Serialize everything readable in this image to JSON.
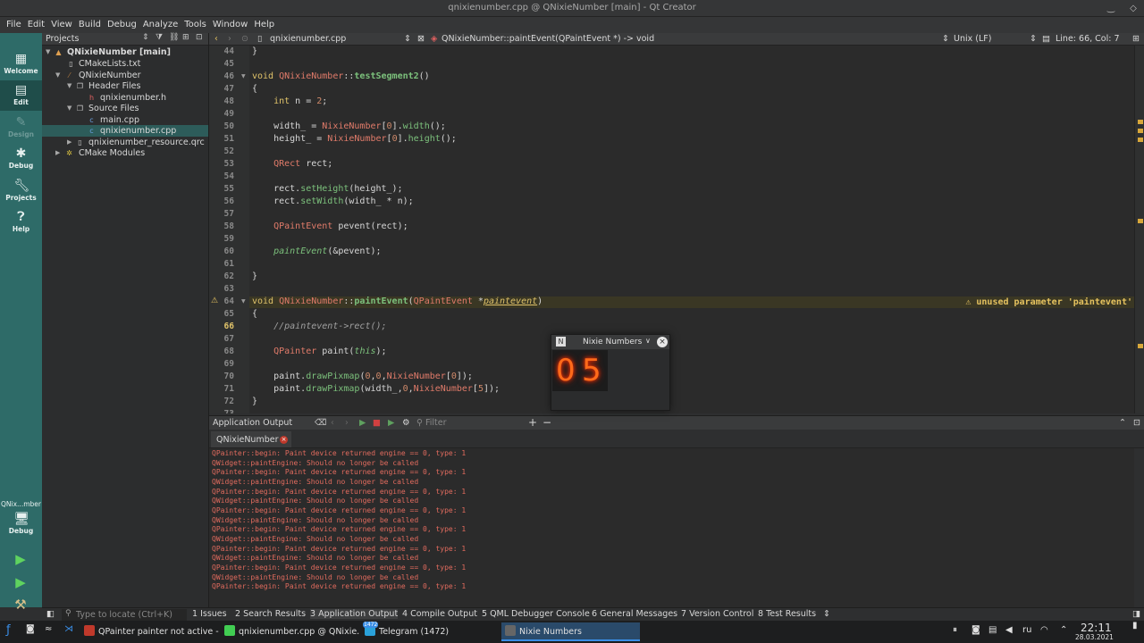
{
  "window": {
    "title": "qnixienumber.cpp @ QNixieNumber [main] - Qt Creator"
  },
  "menu": [
    "File",
    "Edit",
    "View",
    "Build",
    "Debug",
    "Analyze",
    "Tools",
    "Window",
    "Help"
  ],
  "modes": [
    {
      "label": "Welcome",
      "icon": "grid-icon"
    },
    {
      "label": "Edit",
      "icon": "edit-icon"
    },
    {
      "label": "Design",
      "icon": "pencil-icon"
    },
    {
      "label": "Debug",
      "icon": "bug-icon"
    },
    {
      "label": "Projects",
      "icon": "wrench-icon"
    },
    {
      "label": "Help",
      "icon": "help-icon"
    }
  ],
  "kit": {
    "name": "QNix...mber",
    "mode": "Debug"
  },
  "projects_pane": {
    "title": "Projects",
    "tree": [
      {
        "name": "QNixieNumber [main]",
        "bold": true
      },
      {
        "name": "CMakeLists.txt"
      },
      {
        "name": "QNixieNumber"
      },
      {
        "name": "Header Files"
      },
      {
        "name": "qnixienumber.h"
      },
      {
        "name": "Source Files"
      },
      {
        "name": "main.cpp"
      },
      {
        "name": "qnixienumber.cpp"
      },
      {
        "name": "qnixienumber_resource.qrc"
      },
      {
        "name": "CMake Modules"
      }
    ]
  },
  "editor_toolbar": {
    "file": "qnixienumber.cpp",
    "symbol": "QNixieNumber::paintEvent(QPaintEvent *) -> void",
    "line_ending": "Unix (LF)",
    "position": "Line: 66, Col: 7"
  },
  "editor": {
    "line_numbers": [
      "44",
      "45",
      "46",
      "47",
      "48",
      "49",
      "50",
      "51",
      "52",
      "53",
      "54",
      "55",
      "56",
      "57",
      "58",
      "59",
      "60",
      "61",
      "62",
      "63",
      "64",
      "65",
      "66",
      "67",
      "68",
      "69",
      "70",
      "71",
      "72",
      "73"
    ],
    "warning": "unused parameter 'paintevent'"
  },
  "output_pane": {
    "title": "Application Output",
    "filter_placeholder": "Filter",
    "tab": "QNixieNumber",
    "lines": [
      "QPainter::begin: Paint device returned engine == 0, type: 1",
      "QWidget::paintEngine: Should no longer be called",
      "QPainter::begin: Paint device returned engine == 0, type: 1",
      "QWidget::paintEngine: Should no longer be called",
      "QPainter::begin: Paint device returned engine == 0, type: 1",
      "QWidget::paintEngine: Should no longer be called",
      "QPainter::begin: Paint device returned engine == 0, type: 1",
      "QWidget::paintEngine: Should no longer be called",
      "QPainter::begin: Paint device returned engine == 0, type: 1",
      "QWidget::paintEngine: Should no longer be called",
      "QPainter::begin: Paint device returned engine == 0, type: 1",
      "QWidget::paintEngine: Should no longer be called",
      "QPainter::begin: Paint device returned engine == 0, type: 1",
      "QWidget::paintEngine: Should no longer be called",
      "QPainter::begin: Paint device returned engine == 0, type: 1"
    ]
  },
  "panes_bar": {
    "locate_placeholder": "Type to locate (Ctrl+K)",
    "items": [
      "1 Issues",
      "2 Search Results",
      "3 Application Output",
      "4 Compile Output",
      "5 QML Debugger Console",
      "6 General Messages",
      "7 Version Control",
      "8 Test Results"
    ]
  },
  "nixie_window": {
    "title": "Nixie Numbers",
    "digits": [
      "0",
      "5"
    ]
  },
  "taskbar": {
    "items": [
      {
        "label": "QPainter painter not active -...",
        "color": "#c0392b"
      },
      {
        "label": "qnixienumber.cpp @ QNixie...",
        "color": "#41cd52"
      },
      {
        "label": "Telegram (1472)",
        "color": "#2aa1da"
      },
      {
        "label": "Nixie Numbers",
        "color": "#555555"
      }
    ],
    "badge": "1472",
    "lang": "ru",
    "time": "22:11",
    "date": "28.03.2021"
  },
  "colors": {
    "accent": "#2e6b68",
    "warning": "#e6c35f",
    "error_text": "#e16b5e",
    "nixie": "#ff6a1a"
  }
}
